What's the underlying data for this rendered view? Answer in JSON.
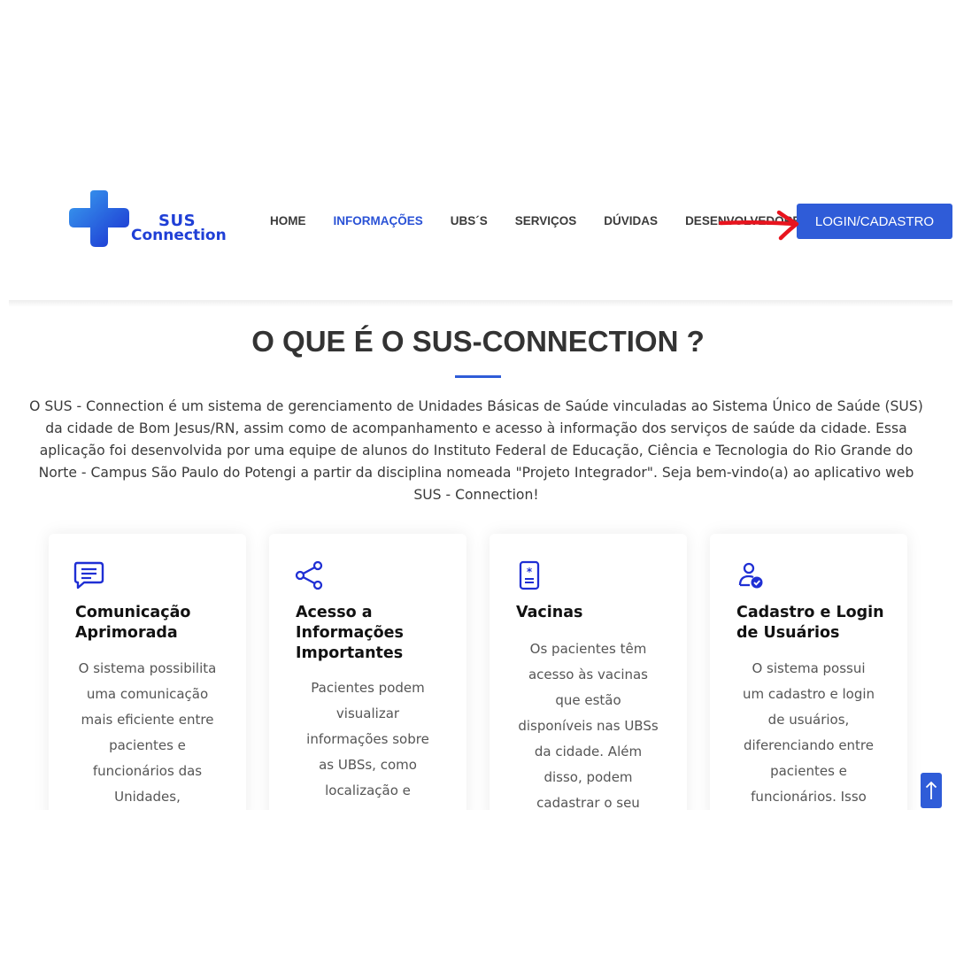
{
  "brand": {
    "line1": "SUS",
    "line2": "Connection",
    "colors": {
      "primary": "#2f5cd8",
      "logo_blue": "#1f3fd6",
      "annotation": "#e8141e"
    }
  },
  "nav": {
    "items": [
      {
        "label": "HOME",
        "active": false
      },
      {
        "label": "INFORMAÇÕES",
        "active": true
      },
      {
        "label": "UBS´S",
        "active": false
      },
      {
        "label": "SERVIÇOS",
        "active": false
      },
      {
        "label": "DÚVIDAS",
        "active": false
      },
      {
        "label": "DESENVOLVEDORES",
        "active": false
      }
    ],
    "login_label": "LOGIN/CADASTRO"
  },
  "section": {
    "title": "O QUE É O SUS-CONNECTION ?",
    "intro_lines": [
      "O SUS - Connection é um sistema de gerenciamento de Unidades Básicas de Saúde vinculadas ao Sistema Único de Saúde (SUS)",
      "da cidade de Bom Jesus/RN, assim como de acompanhamento e acesso à informação dos serviços de saúde da cidade. Essa",
      "aplicação foi desenvolvida por uma equipe de alunos do Instituto Federal de Educação, Ciência e Tecnologia do Rio Grande do",
      "Norte - Campus São Paulo do Potengi a partir da disciplina nomeada \"Projeto Integrador\". Seja bem-vindo(a) ao aplicativo web",
      "SUS - Connection!"
    ]
  },
  "cards": [
    {
      "icon": "message-icon",
      "title_lines": [
        "Comunicação",
        "Aprimorada"
      ],
      "text_lines": [
        "O sistema possibilita",
        "uma comunicação",
        "mais eficiente entre",
        "pacientes e",
        "funcionários das",
        "Unidades,"
      ]
    },
    {
      "icon": "share-icon",
      "title_lines": [
        "Acesso a",
        "Informações",
        "Importantes"
      ],
      "text_lines": [
        "Pacientes podem",
        "visualizar",
        "informações sobre",
        "as UBSs, como",
        "localização e"
      ]
    },
    {
      "icon": "vaccine-card-icon",
      "title_lines": [
        "Vacinas"
      ],
      "text_lines": [
        "Os pacientes têm",
        "acesso às vacinas",
        "que estão",
        "disponíveis nas UBSs",
        "da cidade. Além",
        "disso, podem",
        "cadastrar o seu"
      ]
    },
    {
      "icon": "user-check-icon",
      "title_lines": [
        "Cadastro e Login",
        "de Usuários"
      ],
      "text_lines": [
        "O sistema possui",
        "um cadastro e login",
        "de usuários,",
        "diferenciando entre",
        "pacientes e",
        "funcionários. Isso"
      ]
    }
  ],
  "back_to_top_icon": "arrow-up-icon"
}
